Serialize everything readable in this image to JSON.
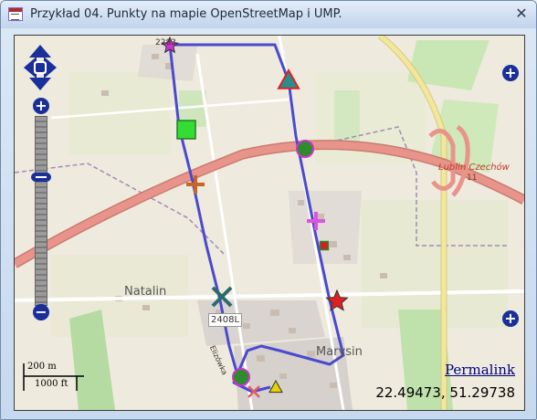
{
  "window": {
    "title": "Przykład 04. Punkty na mapie OpenStreetMap i UMP.",
    "close_glyph": "✕",
    "app_icon": "form-icon"
  },
  "map": {
    "labels": {
      "natalin": "Natalin",
      "marysin": "Marysin",
      "lublin": "Lublin Czechów",
      "exit_number": "11",
      "road_shield_main": "2408L",
      "road_shield_top": "2283",
      "street_name": "Elizówka"
    },
    "controls": {
      "pan_icon": "pan-arrows-icon",
      "zoom_in_glyph": "+",
      "zoom_out_glyph": "−",
      "layer_plus_glyph": "+",
      "zoom_level_fraction": 0.32
    },
    "scale": {
      "metric": "200 m",
      "imperial": "1000 ft"
    },
    "permalink_label": "Permalink",
    "coordinates_readout": "22.49473, 51.29738",
    "colors": {
      "route": "#4a4ad0",
      "highway": "#e8948a",
      "road_yellow": "#f2e79a",
      "map_bg": "#eeeadd"
    },
    "markers": [
      {
        "name": "star-marker-magenta",
        "shape": "star",
        "color": "#cc33cc"
      },
      {
        "name": "triangle-marker-teal",
        "shape": "triangle",
        "color": "#2a8d8d"
      },
      {
        "name": "square-marker-green",
        "shape": "square",
        "color": "#33dd33"
      },
      {
        "name": "circle-marker-green",
        "shape": "circle",
        "color": "#2e8b2e"
      },
      {
        "name": "cross-marker-orange",
        "shape": "plus",
        "color": "#c86424"
      },
      {
        "name": "cross-marker-magenta",
        "shape": "plus",
        "color": "#dd55dd"
      },
      {
        "name": "square-marker-small",
        "shape": "square",
        "color": "#cc2222"
      },
      {
        "name": "x-marker-teal",
        "shape": "x",
        "color": "#2a6b6b"
      },
      {
        "name": "star-marker-red",
        "shape": "star",
        "color": "#e02020"
      },
      {
        "name": "circle-marker-bottom",
        "shape": "circle",
        "color": "#2e8b2e"
      },
      {
        "name": "x-marker-pink",
        "shape": "x",
        "color": "#e06060"
      },
      {
        "name": "triangle-marker-yellow",
        "shape": "triangle",
        "color": "#e6d200"
      }
    ]
  }
}
